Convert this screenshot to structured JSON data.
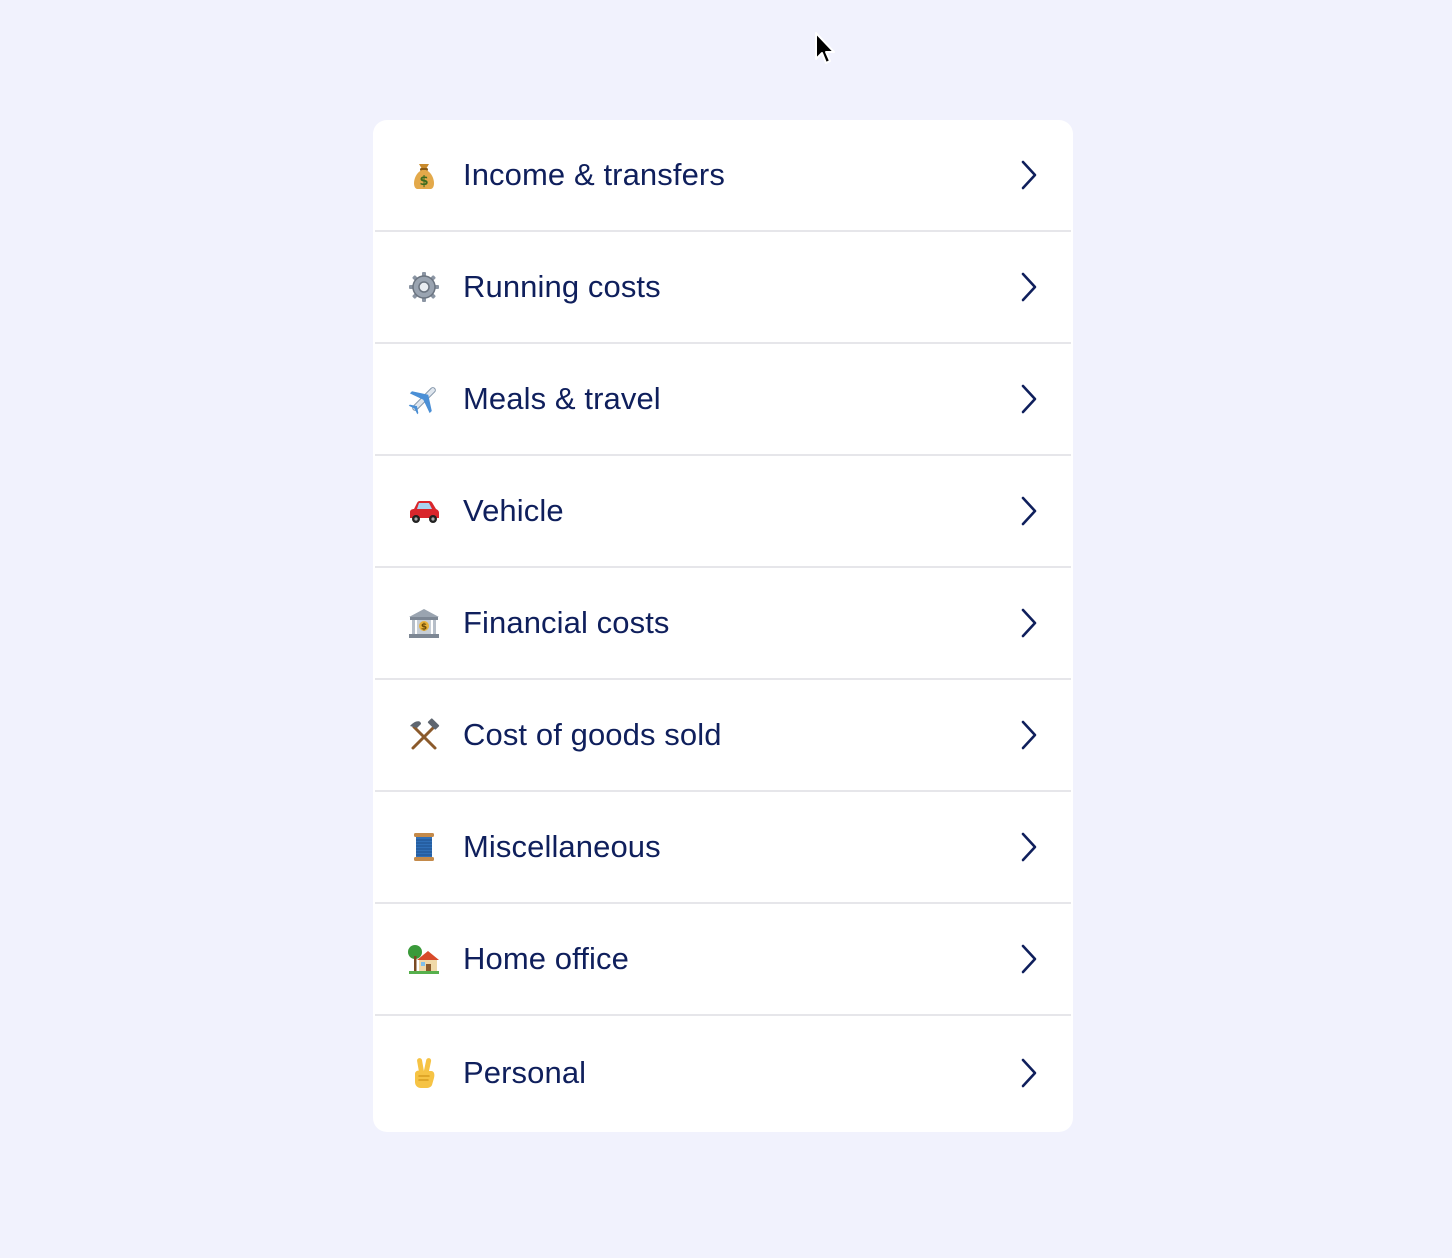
{
  "accent_color": "#0f1f5c",
  "background_color": "#f1f2fd",
  "categories": [
    {
      "label": "Income & transfers",
      "icon": "money-bag-icon"
    },
    {
      "label": "Running costs",
      "icon": "gear-icon"
    },
    {
      "label": "Meals & travel",
      "icon": "airplane-icon"
    },
    {
      "label": "Vehicle",
      "icon": "car-icon"
    },
    {
      "label": "Financial costs",
      "icon": "bank-icon"
    },
    {
      "label": "Cost of goods sold",
      "icon": "hammer-and-pick-icon"
    },
    {
      "label": "Miscellaneous",
      "icon": "thread-spool-icon"
    },
    {
      "label": "Home office",
      "icon": "house-with-garden-icon"
    },
    {
      "label": "Personal",
      "icon": "victory-hand-icon"
    }
  ]
}
